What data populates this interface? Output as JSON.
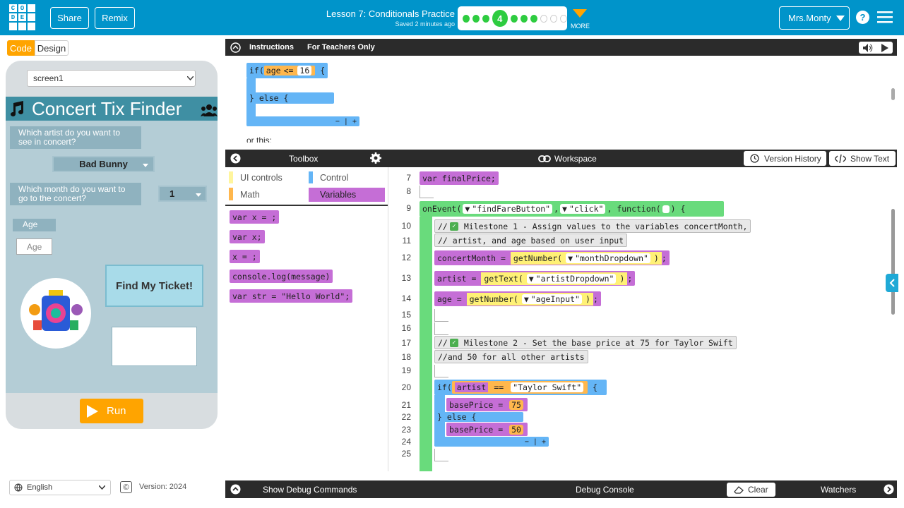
{
  "header": {
    "logo": [
      "C",
      "O",
      "D",
      "E",
      "",
      "",
      ""
    ],
    "share": "Share",
    "remix": "Remix",
    "lesson": "Lesson 7: Conditionals Practice",
    "saved": "Saved 2 minutes ago",
    "level": "4",
    "more": "MORE",
    "user": "Mrs.Monty",
    "help": "?"
  },
  "mode": {
    "code": "Code",
    "design": "Design"
  },
  "app": {
    "screen": "screen1",
    "title": "Concert Tix Finder",
    "q1": "Which artist do you want to see in concert?",
    "artist": "Bad Bunny",
    "q2": "Which month do you want to go to the concert?",
    "month": "1",
    "age_label": "Age",
    "age_placeholder": "Age",
    "button": "Find My Ticket!",
    "run": "Run"
  },
  "footer": {
    "language": "English",
    "version": "Version: 2024"
  },
  "instructions": {
    "tab1": "Instructions",
    "tab2": "For Teachers Only",
    "snip_if": "if(",
    "snip_age": "age",
    "snip_op": "<=",
    "snip_val": "16",
    "snip_else": "} else {",
    "snip_or": "or this:"
  },
  "toolbox": {
    "title": "Toolbox",
    "cats": [
      "UI controls",
      "Control",
      "Math",
      "Variables"
    ],
    "blocks": [
      "var x = ;",
      "var x;",
      "x = ;",
      "console.log(message)",
      "var str = \"Hello World\";"
    ]
  },
  "workspace": {
    "title": "Workspace",
    "version_history": "Version History",
    "show_text": "Show Text",
    "lines": [
      "7",
      "8",
      "9",
      "10",
      "11",
      "12",
      "13",
      "14",
      "15",
      "16",
      "17",
      "18",
      "19",
      "20",
      "21",
      "22",
      "23",
      "24",
      "25"
    ],
    "code": {
      "l7": "var finalPrice;",
      "l9a": "onEvent(",
      "l9b": "\"findFareButton\"",
      "l9c": "\"click\"",
      "l9d": "function(",
      "l10": "Milestone 1 - Assign values to the variables concertMonth,",
      "l11": "artist, and age based on user input",
      "l12a": "concertMonth",
      "l12b": "getNumber(",
      "l12c": "\"monthDropdown\"",
      "l13a": "artist",
      "l13b": "getText(",
      "l13c": "\"artistDropdown\"",
      "l14a": "age",
      "l14b": "getNumber(",
      "l14c": "\"ageInput\"",
      "l17": "Milestone 2 -  Set the base price at 75 for Taylor Swift",
      "l18": "and 50 for all other artists",
      "l20a": "if(",
      "l20b": "artist",
      "l20c": "==",
      "l20d": "\"Taylor Swift\"",
      "l21a": "basePrice",
      "l21b": "75",
      "l22": "} else {",
      "l23a": "basePrice",
      "l23b": "50"
    }
  },
  "debug": {
    "commands": "Show Debug Commands",
    "console": "Debug Console",
    "clear": "Clear",
    "watchers": "Watchers"
  }
}
